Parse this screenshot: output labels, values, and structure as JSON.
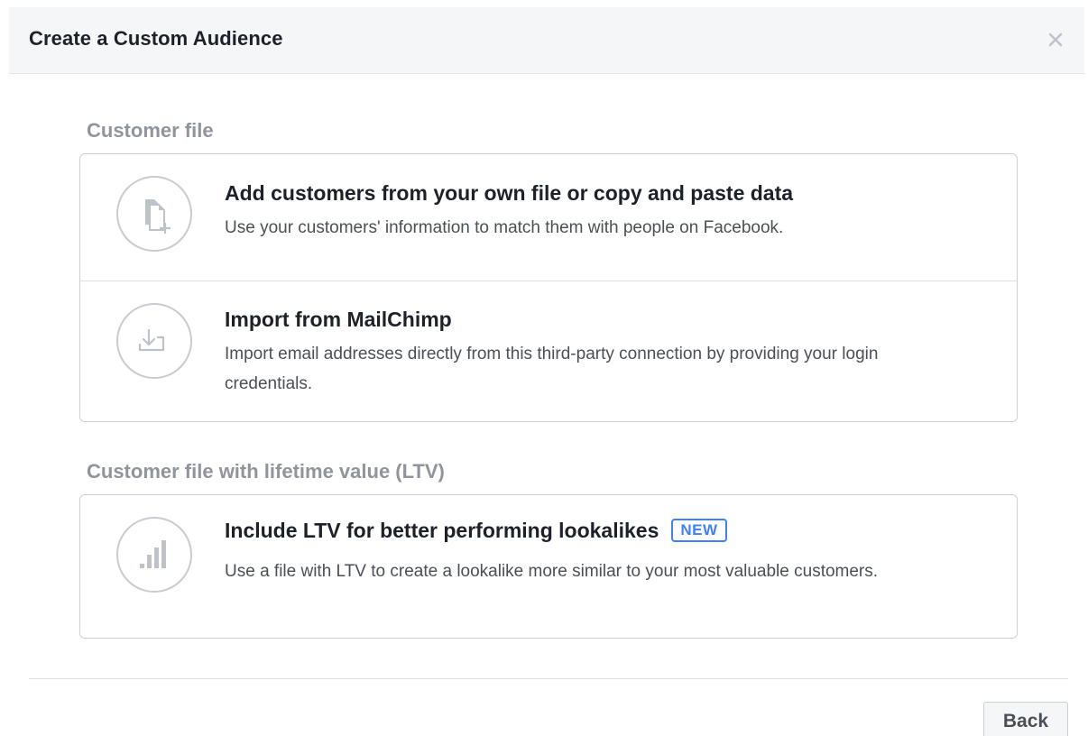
{
  "dialog": {
    "title": "Create a Custom Audience",
    "close_icon": "close-icon"
  },
  "sections": [
    {
      "label": "Customer file",
      "options": [
        {
          "icon": "file-add-icon",
          "title": "Add customers from your own file or copy and paste data",
          "description": "Use your customers' information to match them with people on Facebook."
        },
        {
          "icon": "import-icon",
          "title": "Import from MailChimp",
          "description": "Import email addresses directly from this third-party connection by providing your login credentials."
        }
      ]
    },
    {
      "label": "Customer file with lifetime value (LTV)",
      "options": [
        {
          "icon": "bar-chart-icon",
          "title": "Include LTV for better performing lookalikes",
          "badge": "NEW",
          "description": "Use a file with LTV to create a lookalike more similar to your most valuable customers."
        }
      ]
    }
  ],
  "footer": {
    "back_label": "Back"
  },
  "colors": {
    "header_bg": "#f5f6f7",
    "title_text": "#1d2129",
    "section_label": "#90949c",
    "body_text": "#4b4f56",
    "border": "#ccd0d5",
    "icon_gray": "#bec2c9",
    "badge_blue": "#4080ff"
  }
}
